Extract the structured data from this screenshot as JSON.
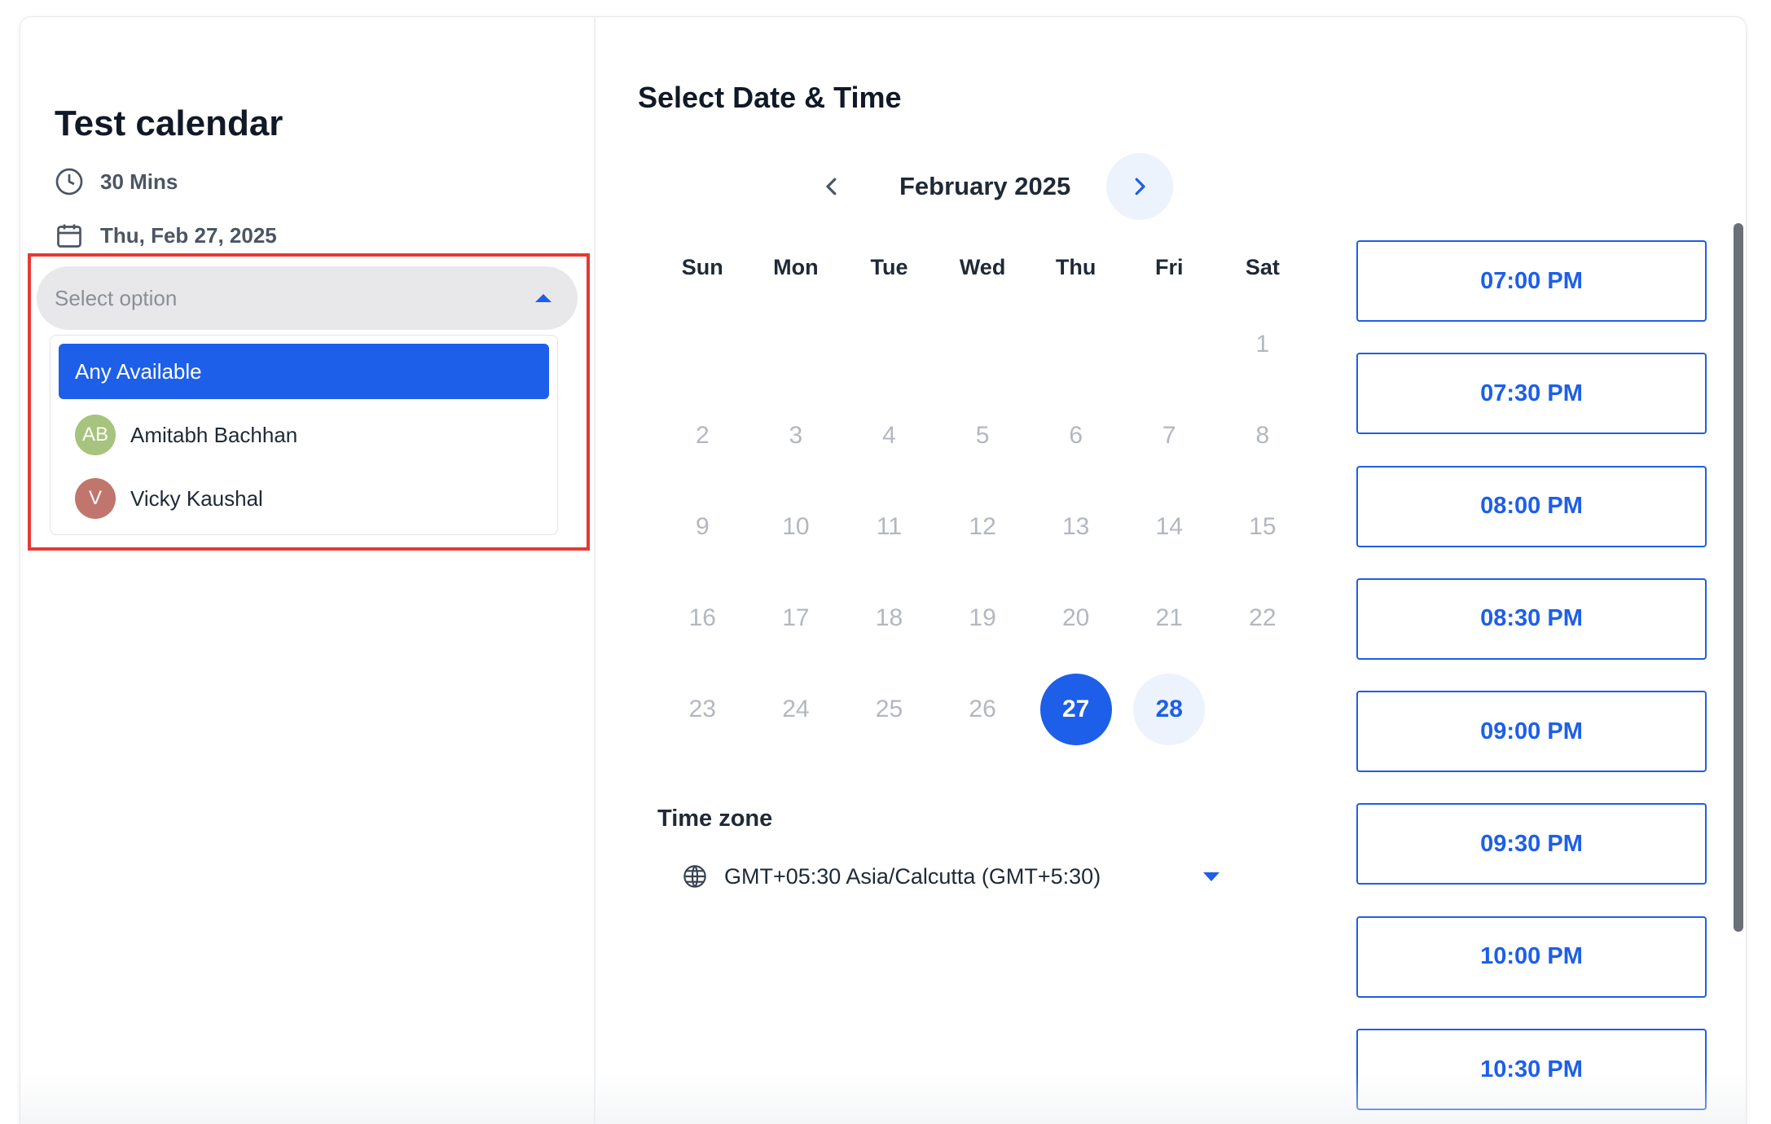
{
  "left": {
    "title": "Test calendar",
    "duration": "30 Mins",
    "date": "Thu, Feb 27, 2025",
    "select": {
      "placeholder": "Select option",
      "options": [
        {
          "label": "Any Available",
          "active": true
        },
        {
          "label": "Amitabh Bachhan",
          "initials": "AB",
          "color": "#a6c47d"
        },
        {
          "label": "Vicky Kaushal",
          "initials": "V",
          "color": "#c0756d"
        }
      ]
    },
    "highlight_color": "#e53935"
  },
  "right": {
    "title": "Select Date & Time",
    "month": "February 2025",
    "weekdays": [
      "Sun",
      "Mon",
      "Tue",
      "Wed",
      "Thu",
      "Fri",
      "Sat"
    ],
    "days": [
      {
        "n": "1",
        "state": "disabled",
        "offset": 6
      },
      {
        "n": "2",
        "state": "disabled"
      },
      {
        "n": "3",
        "state": "disabled"
      },
      {
        "n": "4",
        "state": "disabled"
      },
      {
        "n": "5",
        "state": "disabled"
      },
      {
        "n": "6",
        "state": "disabled"
      },
      {
        "n": "7",
        "state": "disabled"
      },
      {
        "n": "8",
        "state": "disabled"
      },
      {
        "n": "9",
        "state": "disabled"
      },
      {
        "n": "10",
        "state": "disabled"
      },
      {
        "n": "11",
        "state": "disabled"
      },
      {
        "n": "12",
        "state": "disabled"
      },
      {
        "n": "13",
        "state": "disabled"
      },
      {
        "n": "14",
        "state": "disabled"
      },
      {
        "n": "15",
        "state": "disabled"
      },
      {
        "n": "16",
        "state": "disabled"
      },
      {
        "n": "17",
        "state": "disabled"
      },
      {
        "n": "18",
        "state": "disabled"
      },
      {
        "n": "19",
        "state": "disabled"
      },
      {
        "n": "20",
        "state": "disabled"
      },
      {
        "n": "21",
        "state": "disabled"
      },
      {
        "n": "22",
        "state": "disabled"
      },
      {
        "n": "23",
        "state": "disabled"
      },
      {
        "n": "24",
        "state": "disabled"
      },
      {
        "n": "25",
        "state": "disabled"
      },
      {
        "n": "26",
        "state": "disabled"
      },
      {
        "n": "27",
        "state": "selected"
      },
      {
        "n": "28",
        "state": "available"
      }
    ],
    "timezone_label": "Time zone",
    "timezone_value": "GMT+05:30 Asia/Calcutta (GMT+5:30)",
    "time_slots": [
      "07:00 PM",
      "07:30 PM",
      "08:00 PM",
      "08:30 PM",
      "09:00 PM",
      "09:30 PM",
      "10:00 PM",
      "10:30 PM"
    ],
    "accent_color": "#1d5fe8"
  }
}
